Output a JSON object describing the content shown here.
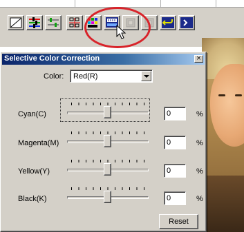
{
  "toolbar": {
    "buttons": [
      {
        "icon": "curves-icon"
      },
      {
        "icon": "color-balance-icon"
      },
      {
        "icon": "levels-icon"
      },
      {
        "icon": "hue-saturation-icon"
      },
      {
        "icon": "selective-color-icon"
      },
      {
        "icon": "variations-icon"
      },
      {
        "icon": "snapshot-icon"
      },
      {
        "icon": "snapshot-alt-icon"
      },
      {
        "icon": "undo-icon"
      },
      {
        "icon": "extra-icon"
      }
    ]
  },
  "dialog": {
    "title": "Selective Color Correction",
    "close_glyph": "×",
    "color_label": "Color:",
    "color_value": "Red(R)",
    "sliders": [
      {
        "label": "Cyan(C)",
        "value": "0",
        "unit": "%"
      },
      {
        "label": "Magenta(M)",
        "value": "0",
        "unit": "%"
      },
      {
        "label": "Yellow(Y)",
        "value": "0",
        "unit": "%"
      },
      {
        "label": "Black(K)",
        "value": "0",
        "unit": "%"
      }
    ],
    "reset_label": "Reset"
  },
  "colors": {
    "highlight_ring": "#d8232a",
    "titlebar_start": "#0a246a",
    "titlebar_end": "#a6caf0",
    "face_bg": "#d4d0c8"
  }
}
